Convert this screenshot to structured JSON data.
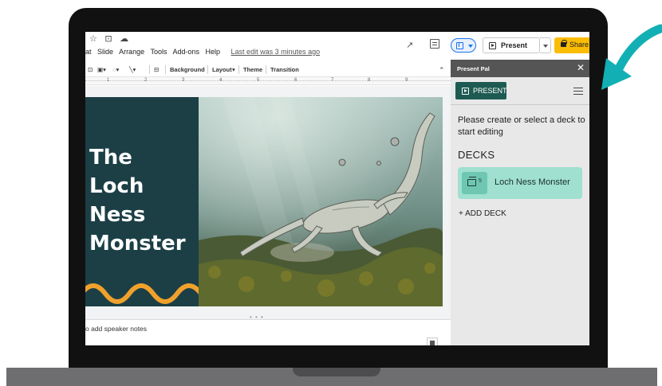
{
  "slides_app": {
    "menu": [
      "at",
      "Slide",
      "Arrange",
      "Tools",
      "Add-ons",
      "Help"
    ],
    "last_edit": "Last edit was 3 minutes ago",
    "top_icons": [
      "star-icon",
      "folder-move-icon",
      "cloud-status-icon"
    ],
    "present_label": "Present",
    "share_label": "Share",
    "toolbar": {
      "background": "Background",
      "layout": "Layout",
      "theme": "Theme",
      "transition": "Transition"
    },
    "ruler_ticks": [
      "1",
      "2",
      "3",
      "4",
      "5",
      "6",
      "7",
      "8",
      "9"
    ],
    "notes_placeholder": "o add speaker notes"
  },
  "slide": {
    "title_lines": [
      "The",
      "Loch",
      "Ness",
      "Monster"
    ],
    "left_panel_color": "#1c3f46",
    "wave_color": "#f0a12b"
  },
  "sidebar": {
    "title": "Present Pal",
    "close_glyph": "✕",
    "present_button": "PRESENT",
    "message": "Please create or select a deck to start editing",
    "decks_heading": "DECKS",
    "decks": [
      {
        "name": "Loch Ness Monster",
        "count": "5"
      }
    ],
    "add_deck": "+ ADD DECK"
  },
  "colors": {
    "accent_teal": "#1d5b52",
    "deck_card": "#9fe0d0",
    "share_yellow": "#fbbc04",
    "arrow_teal": "#12b0b4",
    "laptop_bezel": "#111111",
    "laptop_base": "#6e6e70"
  }
}
